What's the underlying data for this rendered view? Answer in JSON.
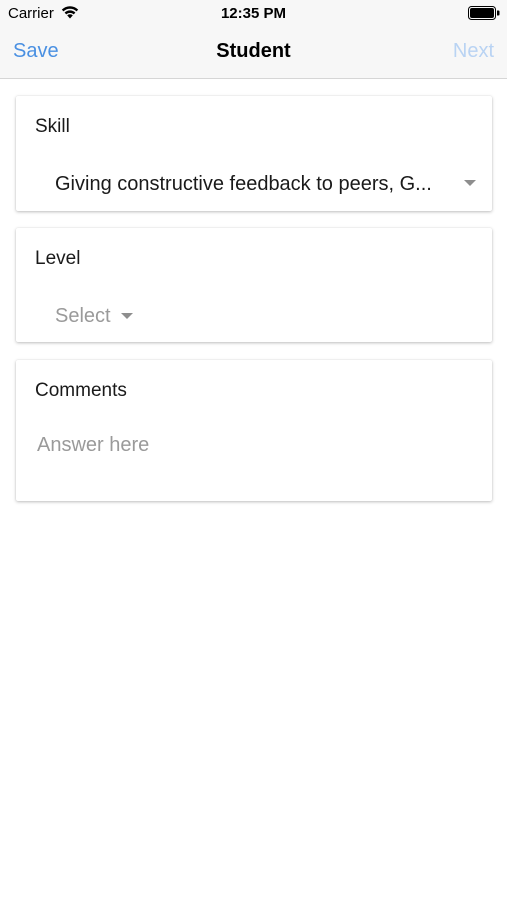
{
  "status_bar": {
    "carrier": "Carrier",
    "time": "12:35 PM",
    "wifi_icon": "wifi-icon",
    "battery_icon": "battery-icon"
  },
  "nav": {
    "save_label": "Save",
    "title": "Student",
    "next_label": "Next",
    "accent_color": "#4a90e2",
    "disabled_color": "#b9d3f3"
  },
  "form": {
    "skill": {
      "label": "Skill",
      "value": "Giving constructive feedback to peers, G...",
      "icon": "chevron-down-icon"
    },
    "level": {
      "label": "Level",
      "placeholder": "Select",
      "icon": "chevron-down-icon"
    },
    "comments": {
      "label": "Comments",
      "placeholder": "Answer here",
      "value": ""
    }
  }
}
